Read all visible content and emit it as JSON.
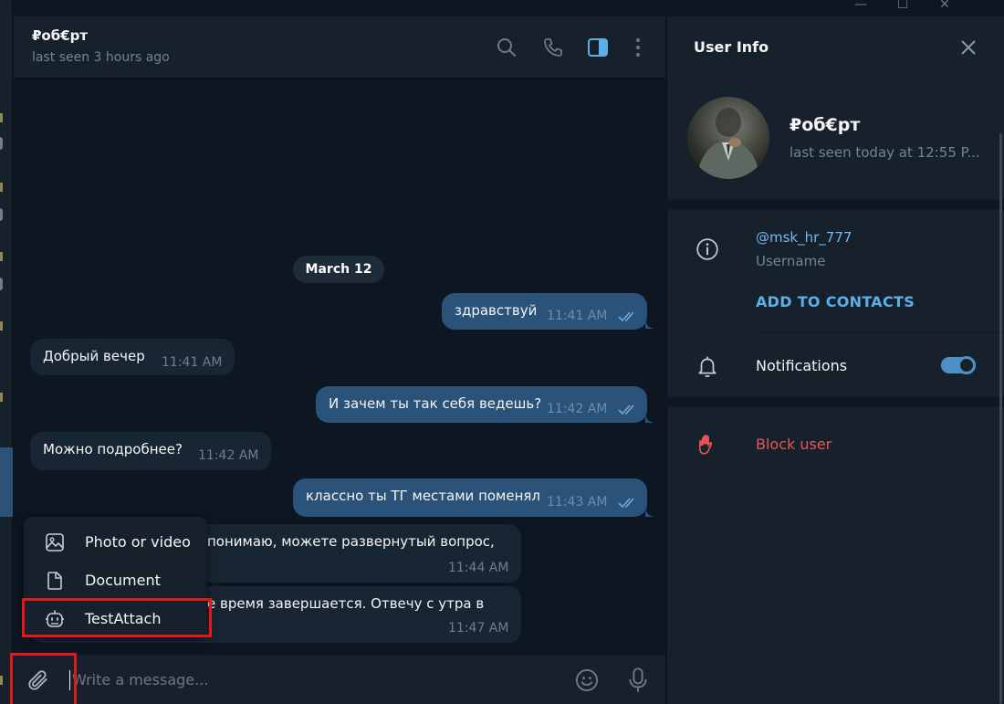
{
  "window": {
    "minimize_glyph": "—",
    "maximize_glyph": "☐",
    "close_glyph": "✕"
  },
  "chat_header": {
    "title": "₽об€рт",
    "status": "last seen 3 hours ago",
    "icons": [
      "search-icon",
      "phone-icon",
      "sidebar-toggle-icon",
      "more-vertical-icon"
    ]
  },
  "messages": {
    "date_divider": "March 12",
    "items": [
      {
        "direction": "out",
        "text": "здравствуй",
        "time": "11:41 AM",
        "read": true
      },
      {
        "direction": "in",
        "text": "Добрый вечер",
        "time": "11:41 AM"
      },
      {
        "direction": "out",
        "text": "И зачем ты так себя ведешь?",
        "time": "11:42 AM",
        "read": true
      },
      {
        "direction": "in",
        "text": "Можно подробнее?",
        "time": "11:42 AM"
      },
      {
        "direction": "out",
        "text": "классно ты ТГ местами поменял",
        "time": "11:43 AM",
        "read": true
      },
      {
        "direction": "in",
        "text": "понимаю, можете развернутый вопрос,",
        "time": "11:44 AM"
      },
      {
        "direction": "in",
        "text": "е время завершается. Отвечу с утра в",
        "time": "11:47 AM"
      }
    ]
  },
  "attach_menu": {
    "items": [
      {
        "label": "Photo or video",
        "icon": "image-icon"
      },
      {
        "label": "Document",
        "icon": "document-icon"
      },
      {
        "label": "TestAttach",
        "icon": "bot-icon"
      }
    ]
  },
  "composer": {
    "placeholder": "Write a message...",
    "icons": [
      "paperclip-icon",
      "emoji-icon",
      "microphone-icon"
    ]
  },
  "user_info": {
    "title": "User Info",
    "name": "₽об€рт",
    "status": "last seen today at 12:55 P...",
    "username": "@msk_hr_777",
    "username_caption": "Username",
    "add_contacts": "ADD TO CONTACTS",
    "notifications_label": "Notifications",
    "notifications_on": true,
    "block_label": "Block user"
  },
  "colors": {
    "accent": "#5eaee8",
    "outgoing_bubble": "#2b5278",
    "incoming_bubble": "#182533",
    "danger": "#e85454",
    "highlight_box": "#e11919"
  }
}
